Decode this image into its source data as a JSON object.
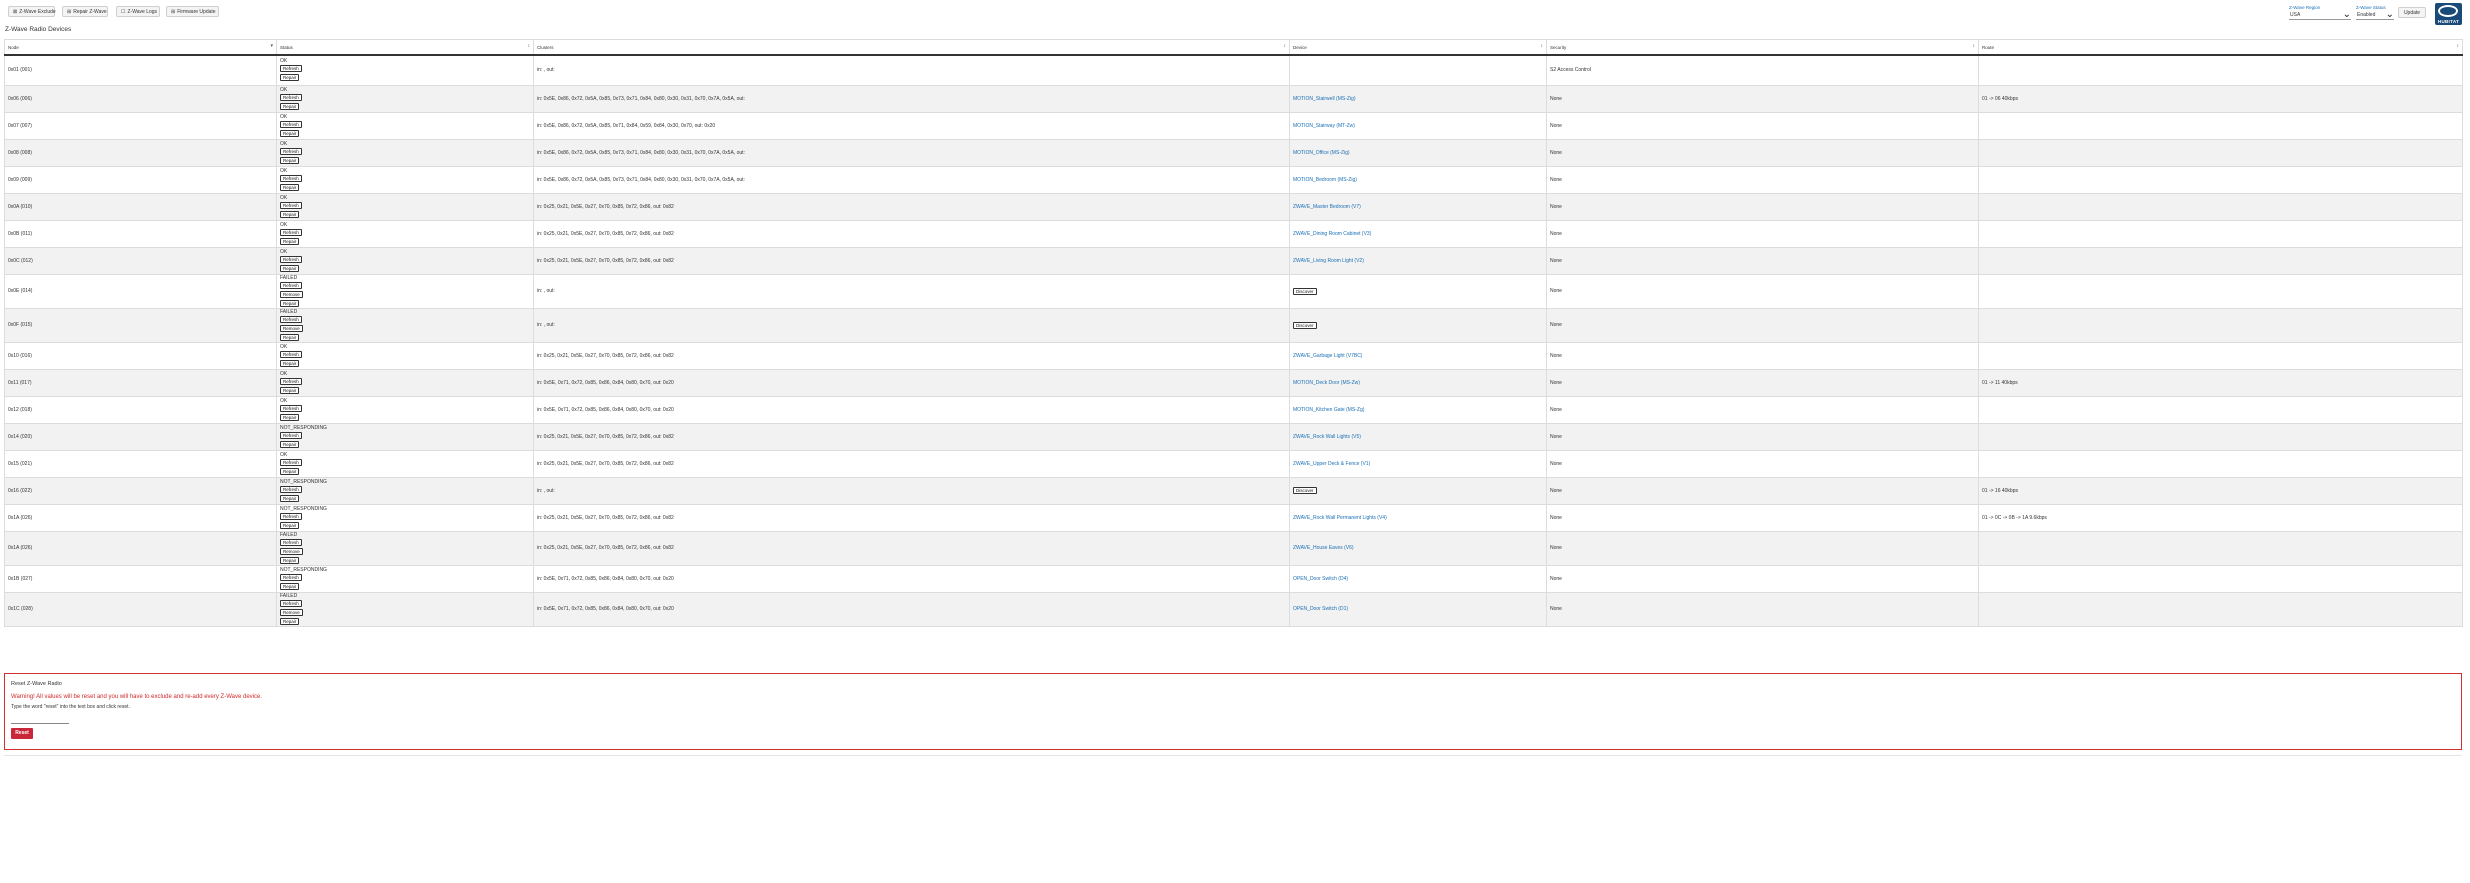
{
  "toolbar": {
    "buttons": [
      {
        "icon": "⊠",
        "label": "Z-Wave Exclude"
      },
      {
        "icon": "⊞",
        "label": "Repair Z-Wave"
      },
      {
        "icon": "☐",
        "label": "Z-Wave Logs"
      },
      {
        "icon": "⊞",
        "label": "Firmware Update"
      }
    ]
  },
  "page_title": "Z-Wave Radio Devices",
  "selects": {
    "zwave_region": {
      "label": "Z-Wave Region",
      "value": "USA"
    },
    "zwave_status": {
      "label": "Z-Wave Status",
      "value": "Enabled"
    }
  },
  "update_label": "Update",
  "logo_text": "HUBITAT",
  "table": {
    "headers": [
      "Node",
      "Status",
      "Clusters",
      "Device",
      "Security",
      "Route"
    ],
    "button_labels": {
      "refresh": "Refresh",
      "repair": "Repair",
      "remove": "Remove",
      "discover": "Discover"
    },
    "rows": [
      {
        "node": "0x01 (001)",
        "status": "OK",
        "buttons": [
          "refresh",
          "repair"
        ],
        "clusters": "in: , out:",
        "device": "",
        "discover": false,
        "security": "S2 Access Control",
        "route": ""
      },
      {
        "node": "0x06 (006)",
        "status": "OK",
        "buttons": [
          "refresh",
          "repair"
        ],
        "clusters": "in: 0x5E, 0x86, 0x72, 0x5A, 0x85, 0x73, 0x71, 0x84, 0x80, 0x30, 0x31, 0x70, 0x7A, 0x5A, out:",
        "device": "MOTION_Stairwell (MS-Zig)",
        "discover": false,
        "security": "None",
        "route": "01 -> 06 40kbps"
      },
      {
        "node": "0x07 (007)",
        "status": "OK",
        "buttons": [
          "refresh",
          "repair"
        ],
        "clusters": "in: 0x5E, 0x86, 0x72, 0x5A, 0x85, 0x71, 0x84, 0x59, 0x84, 0x30, 0x70, out: 0x20",
        "device": "MOTION_Stairway (MT-Zw)",
        "discover": false,
        "security": "None",
        "route": ""
      },
      {
        "node": "0x08 (008)",
        "status": "OK",
        "buttons": [
          "refresh",
          "repair"
        ],
        "clusters": "in: 0x5E, 0x86, 0x72, 0x5A, 0x85, 0x73, 0x71, 0x84, 0x80, 0x30, 0x31, 0x70, 0x7A, 0x5A, out:",
        "device": "MOTION_Office (MS-Zig)",
        "discover": false,
        "security": "None",
        "route": ""
      },
      {
        "node": "0x09 (009)",
        "status": "OK",
        "buttons": [
          "refresh",
          "repair"
        ],
        "clusters": "in: 0x5E, 0x86, 0x72, 0x5A, 0x85, 0x73, 0x71, 0x84, 0x80, 0x30, 0x31, 0x70, 0x7A, 0x5A, out:",
        "device": "MOTION_Bedroom (MS-Zig)",
        "discover": false,
        "security": "None",
        "route": ""
      },
      {
        "node": "0x0A (010)",
        "status": "OK",
        "buttons": [
          "refresh",
          "repair"
        ],
        "clusters": "in: 0x25, 0x21, 0x5E, 0x27, 0x70, 0x85, 0x72, 0x86, out: 0x82",
        "device": "ZWAVE_Master Bedroom (V7)",
        "discover": false,
        "security": "None",
        "route": ""
      },
      {
        "node": "0x0B (011)",
        "status": "OK",
        "buttons": [
          "refresh",
          "repair"
        ],
        "clusters": "in: 0x25, 0x21, 0x5E, 0x27, 0x70, 0x85, 0x72, 0x86, out: 0x82",
        "device": "ZWAVE_Dining Room Cabinet (V3)",
        "discover": false,
        "security": "None",
        "route": ""
      },
      {
        "node": "0x0C (012)",
        "status": "OK",
        "buttons": [
          "refresh",
          "repair"
        ],
        "clusters": "in: 0x25, 0x21, 0x5E, 0x27, 0x70, 0x85, 0x72, 0x86, out: 0x82",
        "device": "ZWAVE_Living Room Light (V2)",
        "discover": false,
        "security": "None",
        "route": ""
      },
      {
        "node": "0x0E (014)",
        "status": "FAILED",
        "buttons": [
          "refresh",
          "remove",
          "repair"
        ],
        "clusters": "in: , out:",
        "device": "",
        "discover": true,
        "security": "None",
        "route": ""
      },
      {
        "node": "0x0F (015)",
        "status": "FAILED",
        "buttons": [
          "refresh",
          "remove",
          "repair"
        ],
        "clusters": "in: , out:",
        "device": "",
        "discover": true,
        "security": "None",
        "route": ""
      },
      {
        "node": "0x10 (016)",
        "status": "OK",
        "buttons": [
          "refresh",
          "repair"
        ],
        "clusters": "in: 0x25, 0x21, 0x5E, 0x27, 0x70, 0x85, 0x72, 0x86, out: 0x82",
        "device": "ZWAVE_Garbage Light (V7BC)",
        "discover": false,
        "security": "None",
        "route": ""
      },
      {
        "node": "0x11 (017)",
        "status": "OK",
        "buttons": [
          "refresh",
          "repair"
        ],
        "clusters": "in: 0x5E, 0x71, 0x72, 0x85, 0x86, 0x84, 0x80, 0x70, out: 0x20",
        "device": "MOTION_Deck Door (MS-Zw)",
        "discover": false,
        "security": "None",
        "route": "01 -> 11 40kbps"
      },
      {
        "node": "0x12 (018)",
        "status": "OK",
        "buttons": [
          "refresh",
          "repair"
        ],
        "clusters": "in: 0x5E, 0x71, 0x72, 0x85, 0x86, 0x84, 0x80, 0x70, out: 0x20",
        "device": "MOTION_Kitchen Gate (MS-Zg)",
        "discover": false,
        "security": "None",
        "route": ""
      },
      {
        "node": "0x14 (020)",
        "status": "NOT_RESPONDING",
        "buttons": [
          "refresh",
          "repair"
        ],
        "clusters": "in: 0x25, 0x21, 0x5E, 0x27, 0x70, 0x85, 0x72, 0x86, out: 0x82",
        "device": "ZWAVE_Rock Wall Lights (V5)",
        "discover": false,
        "security": "None",
        "route": ""
      },
      {
        "node": "0x15 (021)",
        "status": "OK",
        "buttons": [
          "refresh",
          "repair"
        ],
        "clusters": "in: 0x25, 0x21, 0x5E, 0x27, 0x70, 0x85, 0x72, 0x86, out: 0x82",
        "device": "ZWAVE_Upper Deck & Fence (V1)",
        "discover": false,
        "security": "None",
        "route": ""
      },
      {
        "node": "0x16 (022)",
        "status": "NOT_RESPONDING",
        "buttons": [
          "refresh",
          "repair"
        ],
        "clusters": "in: , out:",
        "device": "",
        "discover": true,
        "security": "None",
        "route": "01 -> 16 40kbps"
      },
      {
        "node": "0x1A (026)",
        "status": "NOT_RESPONDING",
        "buttons": [
          "refresh",
          "repair"
        ],
        "clusters": "in: 0x25, 0x21, 0x5E, 0x27, 0x70, 0x85, 0x72, 0x86, out: 0x82",
        "device": "ZWAVE_Rock Wall Permanent Lights (V4)",
        "discover": false,
        "security": "None",
        "route": "01 -> 0C -> 0B -> 1A 9.6kbps"
      },
      {
        "node": "0x1A (026)",
        "status": "FAILED",
        "buttons": [
          "refresh",
          "remove",
          "repair"
        ],
        "clusters": "in: 0x25, 0x21, 0x5E, 0x27, 0x70, 0x85, 0x72, 0x86, out: 0x82",
        "device": "ZWAVE_House Eaves (V6)",
        "discover": false,
        "security": "None",
        "route": ""
      },
      {
        "node": "0x1B (027)",
        "status": "NOT_RESPONDING",
        "buttons": [
          "refresh",
          "repair"
        ],
        "clusters": "in: 0x5E, 0x71, 0x72, 0x85, 0x86, 0x84, 0x80, 0x70, out: 0x20",
        "device": "OPEN_Door Switch (D4)",
        "discover": false,
        "security": "None",
        "route": ""
      },
      {
        "node": "0x1C (028)",
        "status": "FAILED",
        "buttons": [
          "refresh",
          "remove",
          "repair"
        ],
        "clusters": "in: 0x5E, 0x71, 0x72, 0x85, 0x86, 0x84, 0x80, 0x70, out: 0x20",
        "device": "OPEN_Door Switch (D1)",
        "discover": false,
        "security": "None",
        "route": ""
      }
    ]
  },
  "reset": {
    "title": "Reset Z-Wave Radio",
    "warning": "Warning! All values will be reset and you will have to exclude and re-add every Z-Wave device.",
    "hint": "Type the word \"reset\" into the text box and click reset.",
    "input_value": "",
    "button_label": "Reset"
  },
  "colors": {
    "link": "#1a6fb5",
    "danger": "#c9283a",
    "brand": "#1a4a78"
  }
}
